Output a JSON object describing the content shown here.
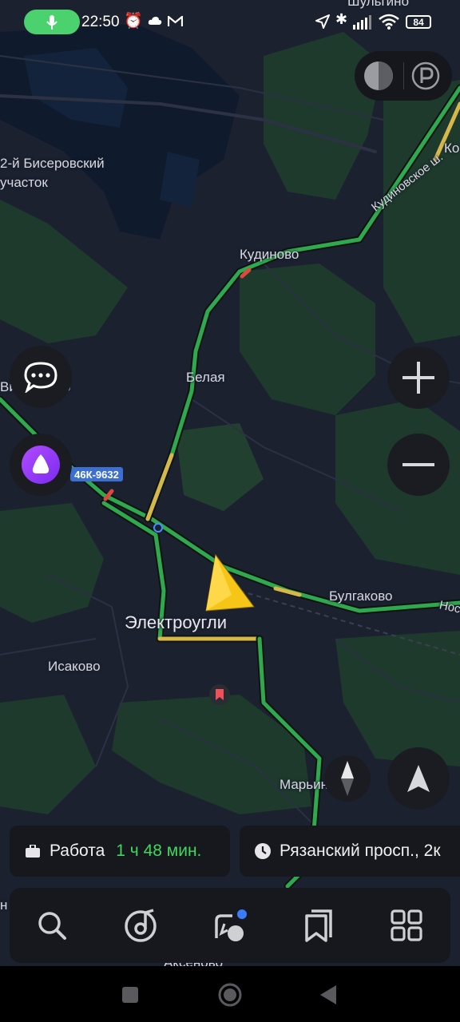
{
  "status_bar": {
    "time": "22:50",
    "battery": "84",
    "icons": [
      "mic-icon",
      "alarm-icon",
      "cloud-icon",
      "gmail-icon",
      "location-icon",
      "bluetooth-icon",
      "signal-icon",
      "wifi-icon"
    ]
  },
  "map": {
    "labels": {
      "top_village": "Шульгино",
      "bisery": "2-й Бисеровский",
      "uchastok": "участок",
      "kudinovo": "Кудиново",
      "kudinovskoe": "Кудиновское ш.",
      "ko": "Ко",
      "belaya": "Белая",
      "vishnyakovo": "Вишняково",
      "road_number": "46К-9632",
      "bulgakovo": "Булгаково",
      "nos": "Нос",
      "elektrougli": "Электроугли",
      "isakovo": "Исаково",
      "maryino": "Марьино",
      "aksenovo": "Аксеново",
      "left_n": "н"
    },
    "colors": {
      "background": "#1c2130",
      "forest": "#1f3a2c",
      "water": "#0f1b2d",
      "traffic_green": "#2fa84f",
      "traffic_yellow": "#d7b74a",
      "traffic_red": "#e0473d",
      "arrow": "#f5c517"
    }
  },
  "controls": {
    "zoom_in_icon": "plus-icon",
    "zoom_out_icon": "minus-icon",
    "chat_icon": "chat-icon",
    "alice_icon": "alice-icon",
    "compass_icon": "compass-icon",
    "locate_icon": "navigation-arrow-icon",
    "layers_icon": "layers-icon",
    "parking_icon": "parking-icon"
  },
  "routes": [
    {
      "icon": "briefcase-icon",
      "title": "Работа",
      "time": "1 ч 48 мин."
    },
    {
      "icon": "clock-icon",
      "title": "Рязанский просп., 2к"
    }
  ],
  "bottom_tabs": [
    "search-icon",
    "music-icon",
    "navigator-icon",
    "bookmarks-icon",
    "services-icon"
  ]
}
